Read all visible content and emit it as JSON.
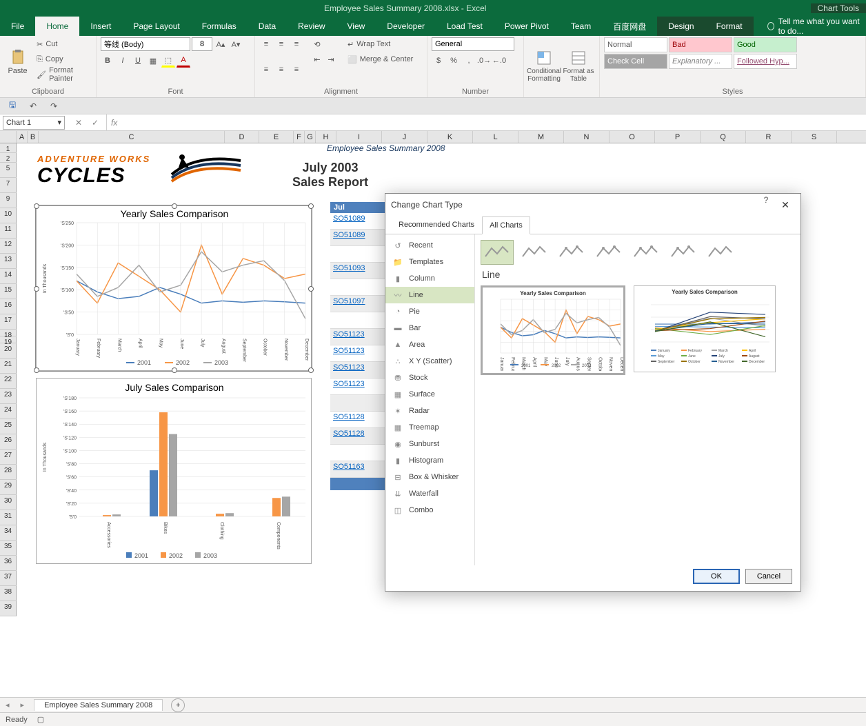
{
  "title": "Employee Sales Summary 2008.xlsx - Excel",
  "chart_tools_label": "Chart Tools",
  "tabs": {
    "file": "File",
    "home": "Home",
    "insert": "Insert",
    "page_layout": "Page Layout",
    "formulas": "Formulas",
    "data": "Data",
    "review": "Review",
    "view": "View",
    "developer": "Developer",
    "load_test": "Load Test",
    "power_pivot": "Power Pivot",
    "team": "Team",
    "baidu": "百度网盘",
    "design": "Design",
    "format": "Format"
  },
  "tell_me": "Tell me what you want to do...",
  "clipboard": {
    "paste": "Paste",
    "cut": "Cut",
    "copy": "Copy",
    "painter": "Format Painter",
    "label": "Clipboard"
  },
  "font": {
    "name": "等线 (Body)",
    "size": "8",
    "label": "Font"
  },
  "alignment": {
    "wrap": "Wrap Text",
    "merge": "Merge & Center",
    "label": "Alignment"
  },
  "number": {
    "format": "General",
    "label": "Number"
  },
  "formatting": {
    "cond": "Conditional\nFormatting",
    "table": "Format as\nTable"
  },
  "styles": {
    "label": "Styles",
    "cells": [
      "Normal",
      "Bad",
      "Good",
      "Check Cell",
      "Explanatory ...",
      "Followed Hyp..."
    ]
  },
  "name_box": "Chart 1",
  "sheet": {
    "page_title": "Employee Sales Summary 2008",
    "logo_top": "ADVENTURE WORKS",
    "logo_bottom": "CYCLES",
    "report_line1": "July  2003",
    "report_line2": "Sales Report",
    "orders_header": "Jul",
    "orders": [
      "SO51089",
      "SO51089",
      "",
      "SO51093",
      "",
      "SO51097",
      "",
      "SO51123",
      "SO51123",
      "SO51123",
      "SO51123",
      "",
      "SO51128",
      "SO51128",
      "",
      "SO51163"
    ]
  },
  "chart_data": [
    {
      "type": "line",
      "title": "Yearly Sales Comparison",
      "ylabel": "In Thousands",
      "categories": [
        "January",
        "February",
        "March",
        "April",
        "May",
        "June",
        "July",
        "August",
        "September",
        "October",
        "November",
        "December"
      ],
      "y_ticks": [
        "'S'0",
        "'S'50",
        "'S'100",
        "'S'150",
        "'S'200",
        "'S'250"
      ],
      "ylim": [
        0,
        250
      ],
      "series": [
        {
          "name": "2001",
          "values": [
            120,
            95,
            80,
            85,
            105,
            90,
            70,
            75,
            72,
            75,
            73,
            70
          ]
        },
        {
          "name": "2002",
          "values": [
            120,
            70,
            160,
            130,
            100,
            50,
            200,
            90,
            170,
            155,
            125,
            135
          ]
        },
        {
          "name": "2003",
          "values": [
            135,
            85,
            105,
            155,
            95,
            110,
            185,
            140,
            155,
            165,
            120,
            35
          ]
        }
      ]
    },
    {
      "type": "bar",
      "title": "July  Sales Comparison",
      "ylabel": "In Thousands",
      "categories": [
        "Accessories",
        "Bikes",
        "Clothing",
        "Components"
      ],
      "y_ticks": [
        "'S'0",
        "'S'20",
        "'S'40",
        "'S'60",
        "'S'80",
        "'S'100",
        "'S'120",
        "'S'140",
        "'S'160",
        "'S'180"
      ],
      "ylim": [
        0,
        180
      ],
      "series": [
        {
          "name": "2001",
          "values": [
            0,
            70,
            0,
            0
          ]
        },
        {
          "name": "2002",
          "values": [
            2,
            158,
            4,
            28
          ]
        },
        {
          "name": "2003",
          "values": [
            3,
            125,
            5,
            30
          ]
        }
      ]
    }
  ],
  "dialog": {
    "title": "Change Chart Type",
    "tabs": [
      "Recommended Charts",
      "All Charts"
    ],
    "active_tab": 1,
    "categories": [
      "Recent",
      "Templates",
      "Column",
      "Line",
      "Pie",
      "Bar",
      "Area",
      "X Y (Scatter)",
      "Stock",
      "Surface",
      "Radar",
      "Treemap",
      "Sunburst",
      "Histogram",
      "Box & Whisker",
      "Waterfall",
      "Combo"
    ],
    "selected_category": "Line",
    "subtype_heading": "Line",
    "preview_title": "Yearly Sales Comparison",
    "ok": "OK",
    "cancel": "Cancel"
  },
  "sheet_tab": "Employee Sales Summary 2008",
  "status": "Ready"
}
